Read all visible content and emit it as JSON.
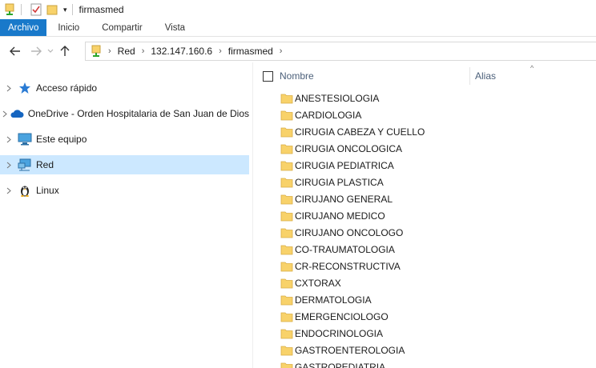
{
  "window": {
    "title": "firmasmed"
  },
  "ribbon": {
    "tabs": [
      {
        "label": "Archivo"
      },
      {
        "label": "Inicio"
      },
      {
        "label": "Compartir"
      },
      {
        "label": "Vista"
      }
    ]
  },
  "address": {
    "crumbs": [
      "Red",
      "132.147.160.6",
      "firmasmed"
    ]
  },
  "nav": {
    "items": [
      {
        "label": "Acceso rápido",
        "icon": "star-icon",
        "selected": false
      },
      {
        "label": "OneDrive - Orden Hospitalaria de San Juan de Dios",
        "icon": "cloud-icon",
        "selected": false
      },
      {
        "label": "Este equipo",
        "icon": "computer-icon",
        "selected": false
      },
      {
        "label": "Red",
        "icon": "network-icon",
        "selected": true
      },
      {
        "label": "Linux",
        "icon": "linux-penguin-icon",
        "selected": false
      }
    ]
  },
  "columns": {
    "name": "Nombre",
    "alias": "Alias"
  },
  "files": [
    {
      "name": "ANESTESIOLOGIA"
    },
    {
      "name": "CARDIOLOGIA"
    },
    {
      "name": "CIRUGIA CABEZA Y CUELLO"
    },
    {
      "name": "CIRUGIA ONCOLOGICA"
    },
    {
      "name": "CIRUGIA PEDIATRICA"
    },
    {
      "name": "CIRUGIA PLASTICA"
    },
    {
      "name": "CIRUJANO GENERAL"
    },
    {
      "name": "CIRUJANO MEDICO"
    },
    {
      "name": "CIRUJANO ONCOLOGO"
    },
    {
      "name": "CO-TRAUMATOLOGIA"
    },
    {
      "name": "CR-RECONSTRUCTIVA"
    },
    {
      "name": "CXTORAX"
    },
    {
      "name": "DERMATOLOGIA"
    },
    {
      "name": "EMERGENCIOLOGO"
    },
    {
      "name": "ENDOCRINOLOGIA"
    },
    {
      "name": "GASTROENTEROLOGIA"
    },
    {
      "name": "GASTROPEDIATRIA"
    }
  ],
  "colors": {
    "file_tab": "#1979ca",
    "selected_nav": "#cce8ff",
    "folder": "#f8d26a",
    "header_text": "#4c607a"
  }
}
